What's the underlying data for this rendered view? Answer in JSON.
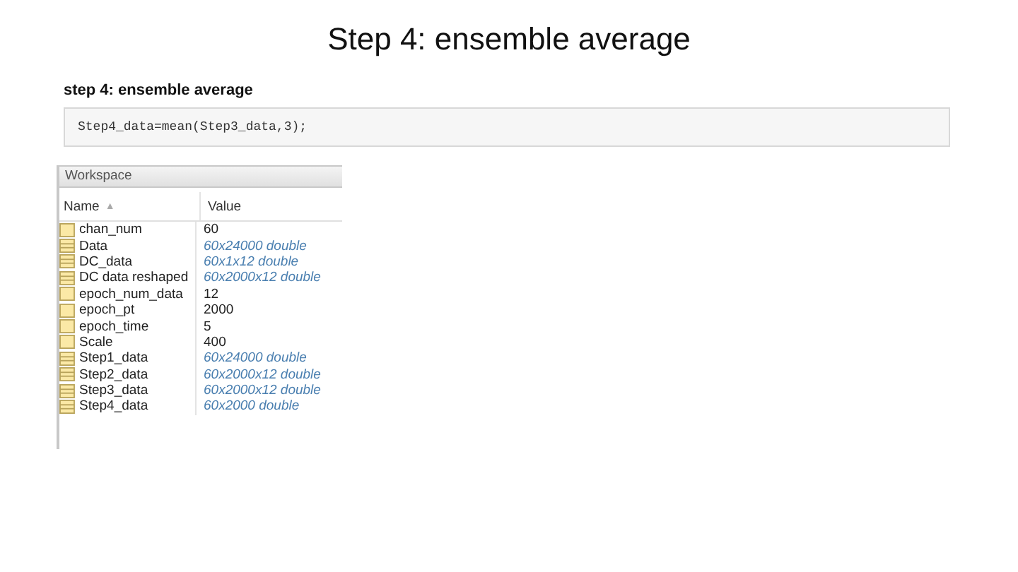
{
  "slide_title": "Step 4: ensemble average",
  "section_heading": "step 4: ensemble average",
  "code": "Step4_data=mean(Step3_data,3);",
  "workspace": {
    "title": "Workspace",
    "columns": [
      {
        "label": "Name",
        "sort_icon": "▲"
      },
      {
        "label": "Value"
      }
    ],
    "rows": [
      {
        "name": "chan_num",
        "value": "60",
        "kind": "scalar"
      },
      {
        "name": "Data",
        "value": "60x24000 double",
        "kind": "array"
      },
      {
        "name": "DC_data",
        "value": "60x1x12 double",
        "kind": "array"
      },
      {
        "name": "DC data reshaped",
        "value": "60x2000x12 double",
        "kind": "array"
      },
      {
        "name": "epoch_num_data",
        "value": "12",
        "kind": "scalar"
      },
      {
        "name": "epoch_pt",
        "value": "2000",
        "kind": "scalar"
      },
      {
        "name": "epoch_time",
        "value": "5",
        "kind": "scalar"
      },
      {
        "name": "Scale",
        "value": "400",
        "kind": "scalar"
      },
      {
        "name": "Step1_data",
        "value": "60x24000 double",
        "kind": "array"
      },
      {
        "name": "Step2_data",
        "value": "60x2000x12 double",
        "kind": "array"
      },
      {
        "name": "Step3_data",
        "value": "60x2000x12 double",
        "kind": "array"
      },
      {
        "name": "Step4_data",
        "value": "60x2000 double",
        "kind": "array"
      }
    ]
  }
}
